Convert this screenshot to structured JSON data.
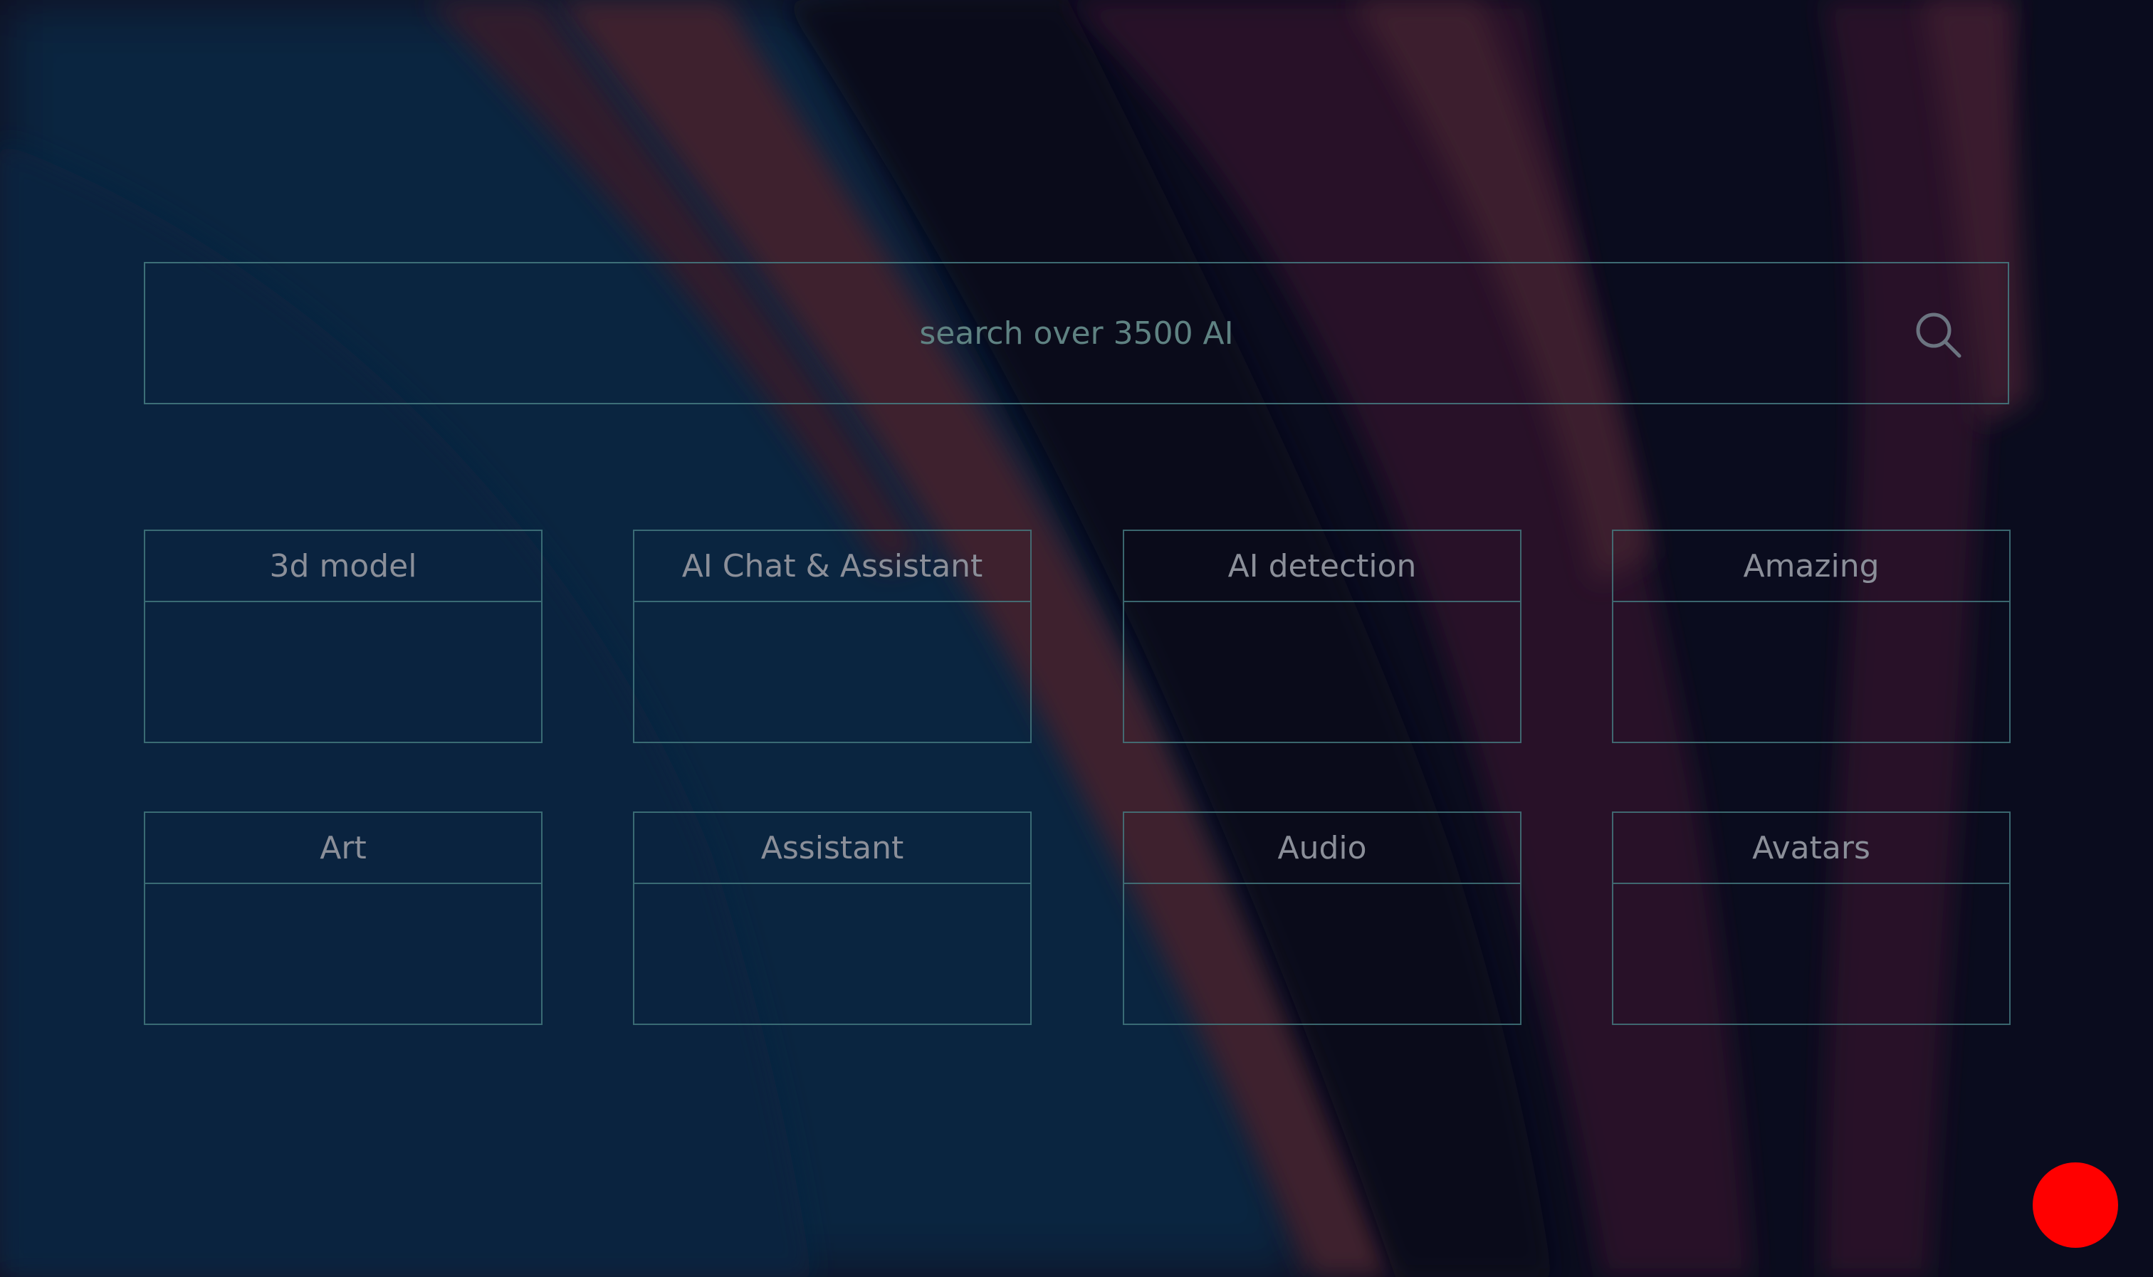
{
  "search": {
    "placeholder": "search over 3500 AI",
    "icon": "search-icon"
  },
  "categories": [
    {
      "label": "3d model"
    },
    {
      "label": "AI Chat & Assistant"
    },
    {
      "label": "AI detection"
    },
    {
      "label": "Amazing"
    },
    {
      "label": "Art"
    },
    {
      "label": "Assistant"
    },
    {
      "label": "Audio"
    },
    {
      "label": "Avatars"
    }
  ],
  "colors": {
    "background": "#0c0f22",
    "border": "#467d82",
    "label": "#8b8f99",
    "placeholder": "#5f8282",
    "record_button": "#ff0000"
  }
}
